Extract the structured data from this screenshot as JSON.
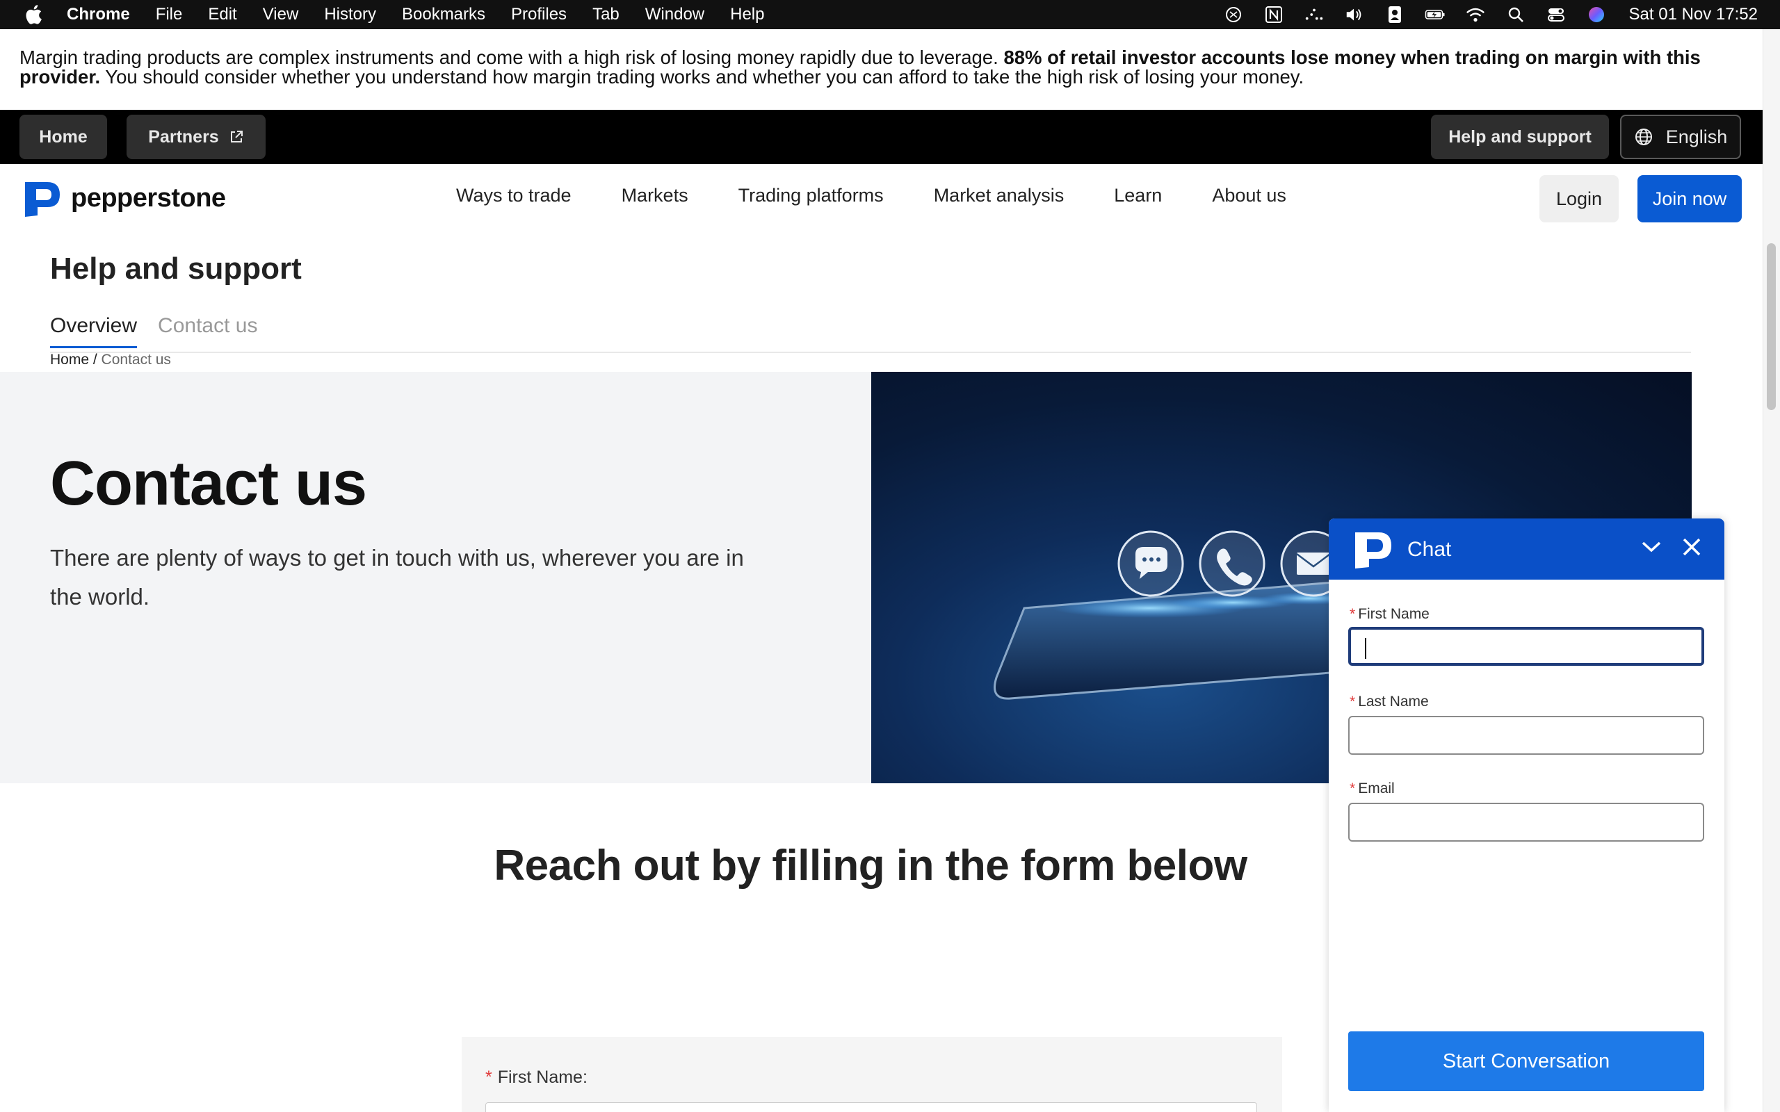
{
  "menubar": {
    "app": "Chrome",
    "items": [
      "File",
      "Edit",
      "View",
      "History",
      "Bookmarks",
      "Profiles",
      "Tab",
      "Window",
      "Help"
    ],
    "clock": "Sat 01 Nov  17:52",
    "status_icons": [
      "chatgpt-icon",
      "notion-icon",
      "dots-icon",
      "volume-icon",
      "contact-icon",
      "battery-icon",
      "wifi-icon",
      "spotlight-icon",
      "control-center-icon",
      "siri-icon"
    ]
  },
  "risk_banner": {
    "part1": "Margin trading products are complex instruments and come with a high risk of losing money rapidly due to leverage. ",
    "bold": "88% of retail investor accounts lose money when trading on margin with this provider.",
    "part2": " You should consider whether you understand how margin trading works and whether you can afford to take the high risk of losing your money."
  },
  "topbar": {
    "home": "Home",
    "partners": "Partners",
    "help": "Help and support",
    "language": "English"
  },
  "nav": {
    "brand": "pepperstone",
    "links": [
      "Ways to trade",
      "Markets",
      "Trading platforms",
      "Market analysis",
      "Learn",
      "About us"
    ],
    "login": "Login",
    "join": "Join now"
  },
  "subheader": {
    "title": "Help and support",
    "tabs": [
      "Overview",
      "Contact us"
    ],
    "breadcrumb_home": "Home",
    "breadcrumb_sep": " / ",
    "breadcrumb_current": "Contact us"
  },
  "hero": {
    "title": "Contact us",
    "text": "There are plenty of ways to get in touch with us, wherever you are in the world."
  },
  "form": {
    "heading": "Reach out by filling in the form below",
    "first_name_label": "First Name:",
    "required_mark": "*"
  },
  "chat": {
    "title": "Chat",
    "required_mark": "*",
    "first_name": "First Name",
    "last_name": "Last Name",
    "email": "Email",
    "first_name_value": "",
    "last_name_value": "",
    "email_value": "",
    "start": "Start Conversation"
  },
  "colors": {
    "brand_blue": "#0a5bd3",
    "chat_header": "#0a50c8",
    "chat_button": "#1e7ae8",
    "required": "#e03b3b"
  }
}
